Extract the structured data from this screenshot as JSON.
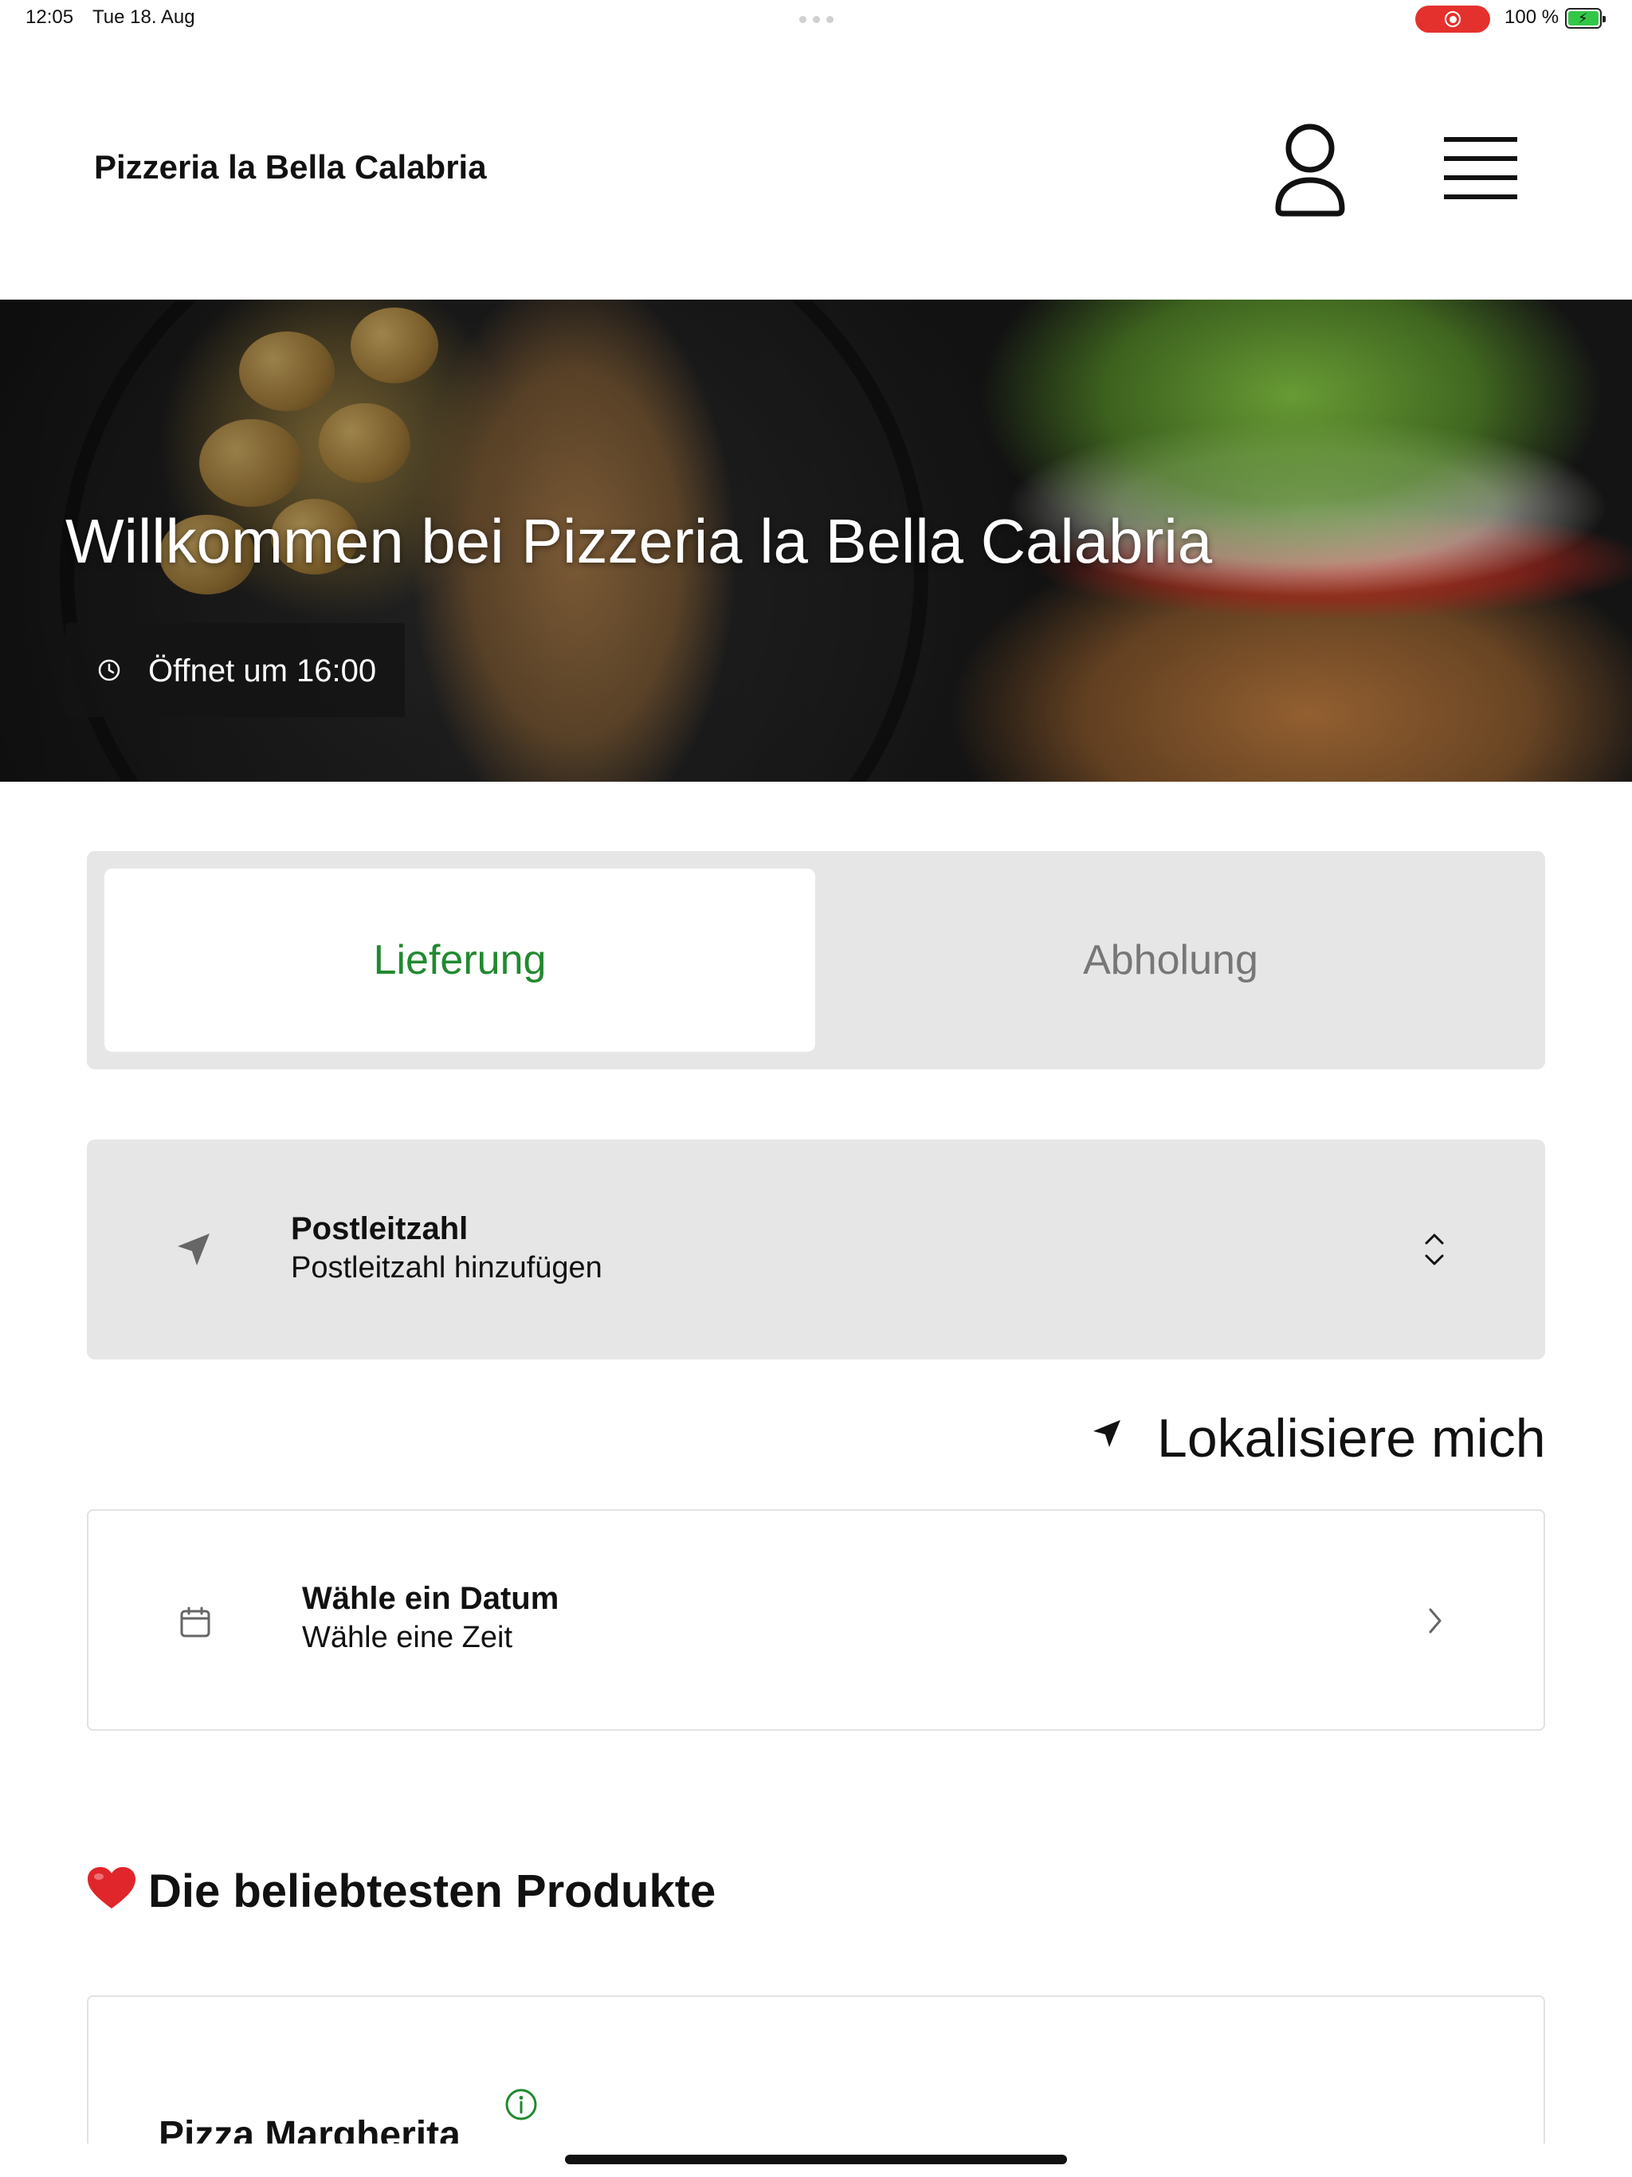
{
  "status_bar": {
    "time": "12:05",
    "date": "Tue 18. Aug",
    "battery_percent": "100 %",
    "battery_level": 1.0,
    "recording_color": "#e5312d"
  },
  "header": {
    "brand": "Pizzeria la Bella Calabria",
    "account_icon": "user-icon",
    "menu_icon": "hamburger-icon"
  },
  "hero": {
    "title": "Willkommen bei Pizzeria la Bella Calabria",
    "opening_text": "Öffnet um 16:00",
    "clock_icon": "clock-icon"
  },
  "order_mode": {
    "tabs": [
      {
        "label": "Lieferung",
        "selected": true
      },
      {
        "label": "Abholung",
        "selected": false
      }
    ],
    "accent_color": "#21892f"
  },
  "postal": {
    "label": "Postleitzahl",
    "placeholder": "Postleitzahl hinzufügen",
    "icon": "location-arrow-icon"
  },
  "locate": {
    "label": "Lokalisiere mich",
    "icon": "location-arrow-icon"
  },
  "schedule": {
    "date_label": "Wähle ein Datum",
    "time_label": "Wähle eine Zeit",
    "icon": "calendar-icon"
  },
  "popular": {
    "title": "Die beliebtesten Produkte",
    "icon": "heart-icon",
    "products": [
      {
        "name": "Pizza Margherita"
      }
    ]
  }
}
